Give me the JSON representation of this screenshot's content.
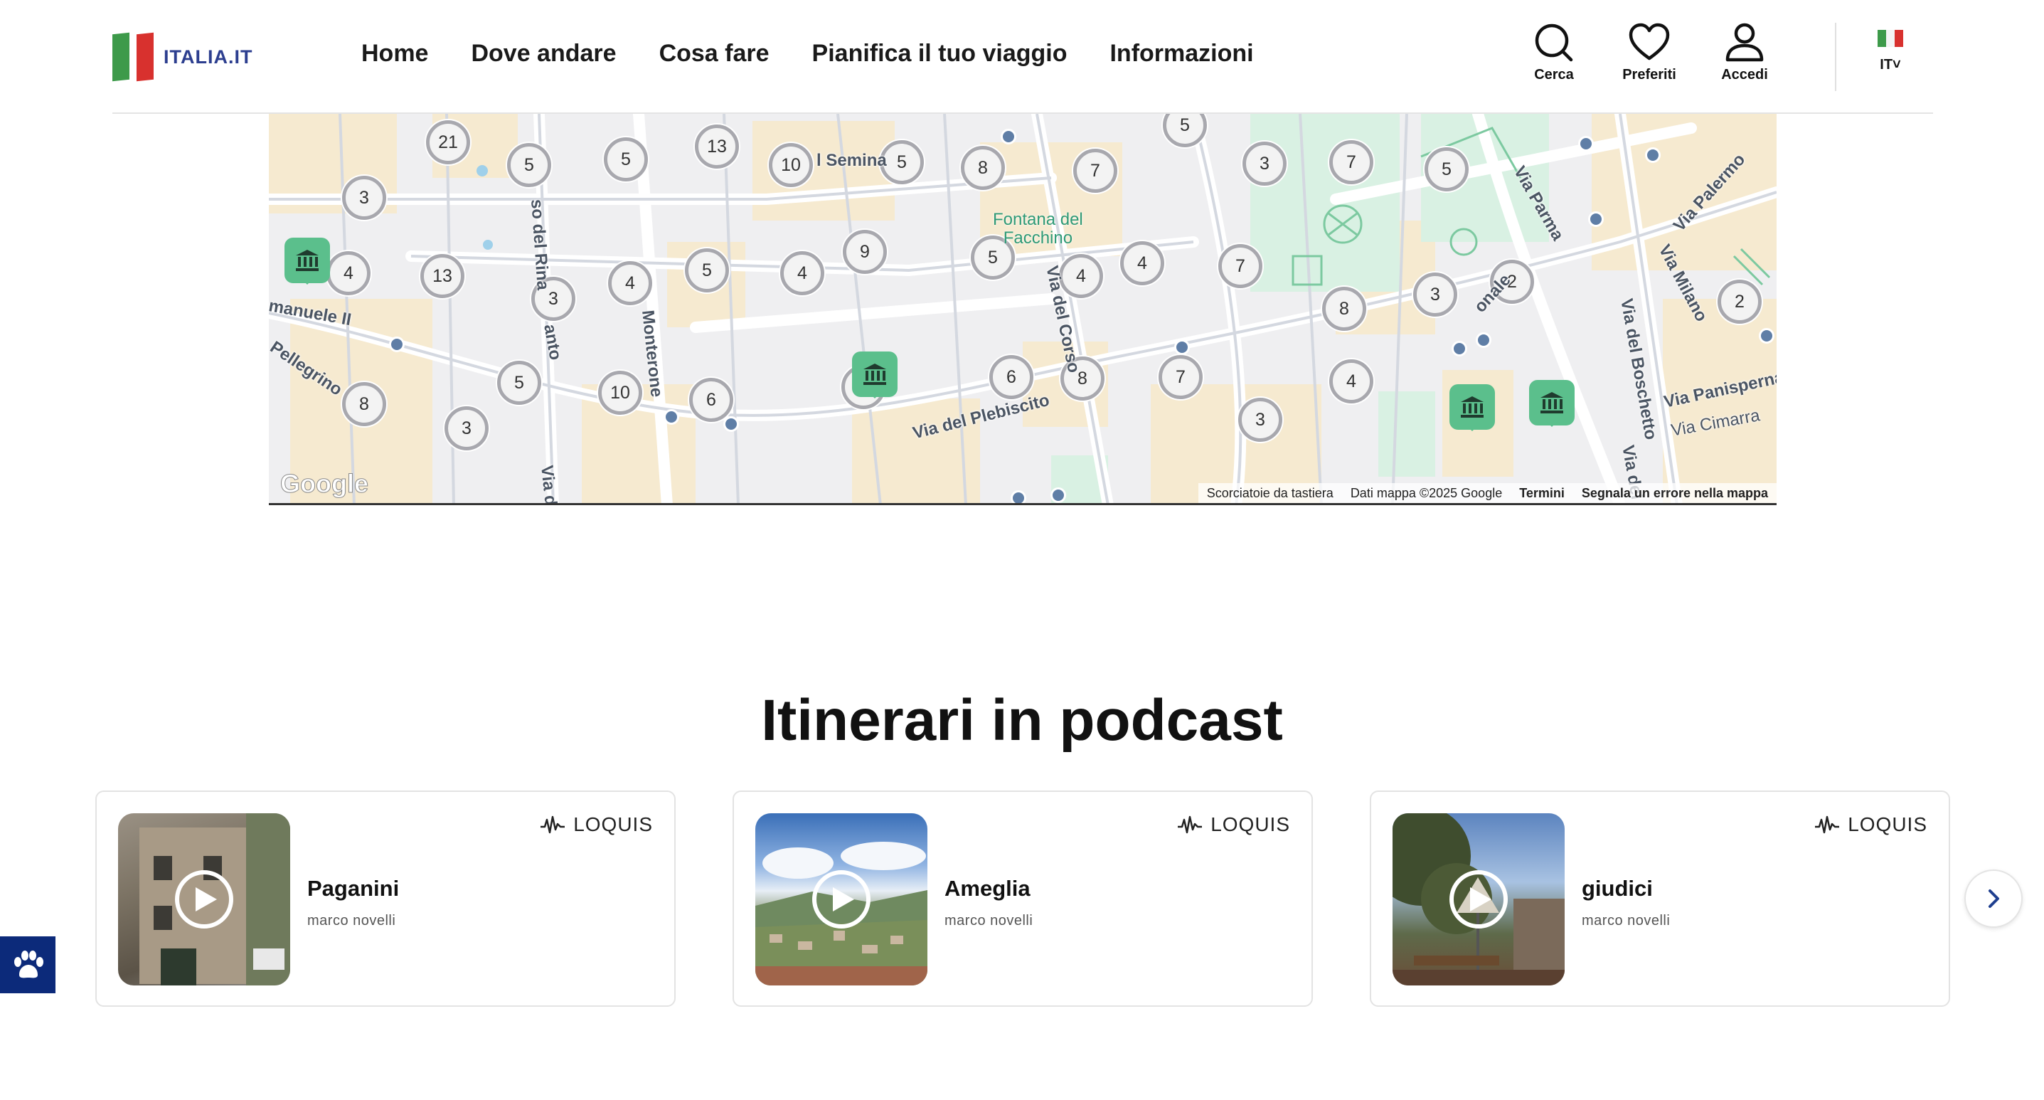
{
  "header": {
    "logo_text": "ITALIA.IT",
    "nav": [
      "Home",
      "Dove andare",
      "Cosa fare",
      "Pianifica il tuo viaggio",
      "Informazioni"
    ],
    "tools": {
      "search": "Cerca",
      "favorites": "Preferiti",
      "login": "Accedi"
    },
    "language": "IT",
    "flag_colors": [
      "#3d9a4a",
      "#ffffff",
      "#d8312e"
    ]
  },
  "map": {
    "clusters": [
      {
        "label": "21"
      },
      {
        "label": "5"
      },
      {
        "label": "5"
      },
      {
        "label": "13"
      },
      {
        "label": "10"
      },
      {
        "label": "5"
      },
      {
        "label": "8"
      },
      {
        "label": "7"
      },
      {
        "label": "5"
      },
      {
        "label": "3"
      },
      {
        "label": "7"
      },
      {
        "label": "5"
      },
      {
        "label": "3"
      },
      {
        "label": "4"
      },
      {
        "label": "13"
      },
      {
        "label": "3"
      },
      {
        "label": "4"
      },
      {
        "label": "5"
      },
      {
        "label": "4"
      },
      {
        "label": "9"
      },
      {
        "label": "5"
      },
      {
        "label": "4"
      },
      {
        "label": "4"
      },
      {
        "label": "7"
      },
      {
        "label": "8"
      },
      {
        "label": "3"
      },
      {
        "label": "2"
      },
      {
        "label": "2"
      },
      {
        "label": "8"
      },
      {
        "label": "3"
      },
      {
        "label": "5"
      },
      {
        "label": "10"
      },
      {
        "label": "6"
      },
      {
        "label": "7"
      },
      {
        "label": "6"
      },
      {
        "label": "8"
      },
      {
        "label": "7"
      },
      {
        "label": "4"
      },
      {
        "label": "3"
      }
    ],
    "streets": [
      "l Semina",
      "so del Rina",
      "anto",
      "Monterone",
      "Via del Corso",
      "Via dei",
      "manuele II",
      "Pellegrino",
      "Via del Plebiscito",
      "Via Parma",
      "Via Palermo",
      "Via Milano",
      "onale",
      "Via del Boschetto",
      "Via Panisperna",
      "Via Cimarra",
      "Via dei S"
    ],
    "place": "Fontana del\nFacchino",
    "logo": "Google",
    "attribution": {
      "shortcuts": "Scorciatoie da tastiera",
      "data": "Dati mappa ©2025 Google",
      "terms": "Termini",
      "report": "Segnala un errore nella mappa"
    }
  },
  "podcast": {
    "title": "Itinerari in podcast",
    "brand": "LOQUIS",
    "cards": [
      {
        "title": "Paganini",
        "author": "marco novelli"
      },
      {
        "title": "Ameglia",
        "author": "marco novelli"
      },
      {
        "title": "giudici",
        "author": "marco novelli"
      }
    ]
  }
}
